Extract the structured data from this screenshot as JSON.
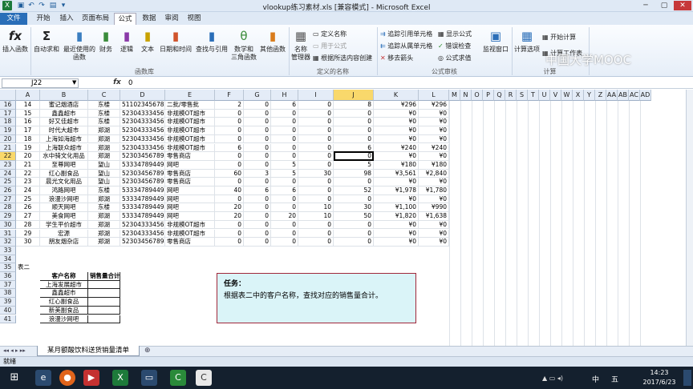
{
  "titlebar": {
    "title": "vlookup练习素材.xls [兼容模式] - Microsoft Excel"
  },
  "tabs": [
    "文件",
    "开始",
    "插入",
    "页面布局",
    "公式",
    "数据",
    "审阅",
    "视图"
  ],
  "ribbon": {
    "insert_function": "插入函数",
    "autosum": "自动求和",
    "recent": "最近使用的\n函数",
    "financial": "财务",
    "logical": "逻辑",
    "text": "文本",
    "datetime": "日期和时间",
    "lookup": "查找与引用",
    "math": "数学和\n三角函数",
    "other": "其他函数",
    "name_mgr": "名称\n管理器",
    "define_name": "定义名称",
    "use_in_formula": "用于公式",
    "create_from_sel": "根据所选内容创建",
    "trace_prec": "追踪引用单元格",
    "trace_dep": "追踪从属单元格",
    "remove_arrows": "移去箭头",
    "show_formulas": "显示公式",
    "error_check": "错误检查",
    "eval_formula": "公式求值",
    "watch": "监视窗口",
    "calc_options": "计算选项",
    "calc_now": "开始计算",
    "calc_sheet": "计算工作表",
    "grp_library": "函数库",
    "grp_names": "定义的名称",
    "grp_audit": "公式审核",
    "grp_calc": "计算",
    "watermark": "中国大学MOOC"
  },
  "formula_bar": {
    "name_box": "J22",
    "fx": "fx",
    "value": "0"
  },
  "columns": [
    "A",
    "B",
    "C",
    "D",
    "E",
    "F",
    "G",
    "H",
    "I",
    "J",
    "K",
    "L",
    "M",
    "N",
    "O",
    "P",
    "Q",
    "R",
    "S",
    "T",
    "U",
    "V",
    "W",
    "X",
    "Y",
    "Z",
    "AA",
    "AB",
    "AC",
    "AD"
  ],
  "row_numbers": [
    "16",
    "17",
    "18",
    "19",
    "20",
    "21",
    "22",
    "23",
    "24",
    "25",
    "26",
    "27",
    "28",
    "29",
    "30",
    "31",
    "32",
    "33",
    "34",
    "35",
    "36",
    "37",
    "38",
    "39",
    "40",
    "41"
  ],
  "rows": [
    [
      "14",
      "蜜记烟酒店",
      "东楼",
      "511023456783",
      "二批/零售批",
      "2",
      "0",
      "6",
      "0",
      "8",
      "¥296",
      "¥296"
    ],
    [
      "15",
      "鑫鑫超市",
      "东楼",
      "523043334567",
      "非规模OT超市",
      "0",
      "0",
      "0",
      "0",
      "0",
      "¥0",
      "¥0"
    ],
    [
      "16",
      "好又佳超市",
      "东楼",
      "523043334567",
      "非规模OT超市",
      "0",
      "0",
      "0",
      "0",
      "0",
      "¥0",
      "¥0"
    ],
    [
      "17",
      "时代大超市",
      "郑湖",
      "523043334567",
      "非规模OT超市",
      "0",
      "0",
      "0",
      "0",
      "0",
      "¥0",
      "¥0"
    ],
    [
      "18",
      "上海如海超市",
      "郑湖",
      "523043334567",
      "非规模OT超市",
      "0",
      "0",
      "0",
      "0",
      "0",
      "¥0",
      "¥0"
    ],
    [
      "19",
      "上海联众超市",
      "郑湖",
      "523043334567",
      "非规模OT超市",
      "6",
      "0",
      "0",
      "0",
      "6",
      "¥240",
      "¥240"
    ],
    [
      "20",
      "水中骑文化用品",
      "郑湖",
      "523034567894",
      "零售商店",
      "0",
      "0",
      "0",
      "0",
      "0",
      "¥0",
      "¥0"
    ],
    [
      "21",
      "至尊网吧",
      "望山",
      "533347894494",
      "网吧",
      "0",
      "0",
      "5",
      "0",
      "5",
      "¥180",
      "¥180"
    ],
    [
      "22",
      "红心副食品",
      "望山",
      "523034567894",
      "零售商店",
      "60",
      "3",
      "5",
      "30",
      "98",
      "¥3,561",
      "¥2,840"
    ],
    [
      "23",
      "晨光文化用品",
      "望山",
      "523034567894",
      "零售商店",
      "0",
      "0",
      "0",
      "0",
      "0",
      "¥0",
      "¥0"
    ],
    [
      "24",
      "鸿路网吧",
      "东楼",
      "533347894494",
      "网吧",
      "40",
      "6",
      "6",
      "0",
      "52",
      "¥1,978",
      "¥1,780"
    ],
    [
      "25",
      "浪漫沙网吧",
      "郑湖",
      "533347894494",
      "网吧",
      "0",
      "0",
      "0",
      "0",
      "0",
      "¥0",
      "¥0"
    ],
    [
      "26",
      "顺天网吧",
      "东楼",
      "533347894494",
      "网吧",
      "20",
      "0",
      "0",
      "10",
      "30",
      "¥1,100",
      "¥990"
    ],
    [
      "27",
      "美食网吧",
      "郑湖",
      "533347894494",
      "网吧",
      "20",
      "0",
      "20",
      "10",
      "50",
      "¥1,820",
      "¥1,638"
    ],
    [
      "28",
      "学生平价超市",
      "郑湖",
      "523043334567",
      "非规模OT超市",
      "0",
      "0",
      "0",
      "0",
      "0",
      "¥0",
      "¥0"
    ],
    [
      "29",
      "宏源",
      "郑湖",
      "523043334567",
      "非规模OT超市",
      "0",
      "0",
      "0",
      "0",
      "0",
      "¥0",
      "¥0"
    ],
    [
      "30",
      "朋友烟杂店",
      "郑湖",
      "523034567894",
      "零售商店",
      "0",
      "0",
      "0",
      "0",
      "0",
      "¥0",
      "¥0"
    ]
  ],
  "table2": {
    "label": "表二",
    "header_name": "客户名称",
    "header_total": "销售量合计",
    "customers": [
      "上海发展超市",
      "鑫鑫超市",
      "红心副食品",
      "新美副食品",
      "浪漫沙网吧"
    ]
  },
  "task": {
    "title": "任务：",
    "body": "根据表二中的客户名称，查找对应的销售量合计。"
  },
  "sheet_tab": "某月额酸饮料送货销量清单",
  "status": "就绪",
  "clock": {
    "time": "14:23",
    "date": "2017/6/23"
  },
  "tray": {
    "lang": "中",
    "ime": "五"
  }
}
